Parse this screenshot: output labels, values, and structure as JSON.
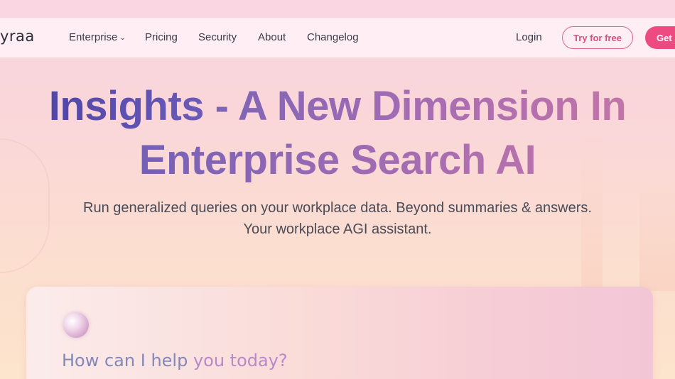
{
  "brand": {
    "logo_text": "yraa"
  },
  "nav": {
    "items": [
      {
        "label": "Enterprise",
        "has_dropdown": true
      },
      {
        "label": "Pricing"
      },
      {
        "label": "Security"
      },
      {
        "label": "About"
      },
      {
        "label": "Changelog"
      }
    ],
    "dropdown_icon": "chevron-down-icon",
    "login_label": "Login",
    "try_label": "Try for free",
    "get_label": "Get"
  },
  "hero": {
    "title_strong": "Insights",
    "title_rest_line1": " - A New Dimension In",
    "title_line2": "Enterprise Search AI",
    "subtitle_line1": "Run generalized queries on your workplace data. Beyond summaries & answers.",
    "subtitle_line2": "Your workplace AGI assistant."
  },
  "chat": {
    "icon": "assistant-orb-icon",
    "prompt_part1": "How can I help ",
    "prompt_part2": "you today?"
  },
  "colors": {
    "accent": "#ec4a80",
    "title_primary": "#5046a8",
    "title_gradient_end": "#c274a8"
  }
}
